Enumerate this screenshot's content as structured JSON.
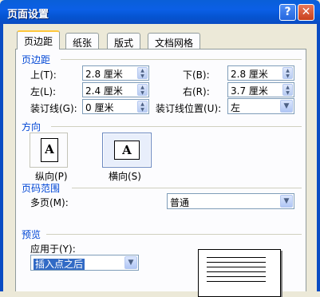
{
  "window": {
    "title": "页面设置",
    "help_button": "?",
    "close_button": "✕"
  },
  "tabs": [
    {
      "label": "页边距",
      "active": true
    },
    {
      "label": "纸张",
      "active": false
    },
    {
      "label": "版式",
      "active": false
    },
    {
      "label": "文档网格",
      "active": false
    }
  ],
  "margins": {
    "group_title": "页边距",
    "top": {
      "label": "上(T):",
      "value": "2.8 厘米"
    },
    "bottom": {
      "label": "下(B):",
      "value": "2.8 厘米"
    },
    "left": {
      "label": "左(L):",
      "value": "2.4 厘米"
    },
    "right": {
      "label": "右(R):",
      "value": "3.7 厘米"
    },
    "gutter": {
      "label": "装订线(G):",
      "value": "0 厘米"
    },
    "gutter_position": {
      "label": "装订线位置(U):",
      "value": "左"
    }
  },
  "orientation": {
    "group_title": "方向",
    "portrait": {
      "label": "纵向(P)",
      "glyph": "A",
      "selected": false
    },
    "landscape": {
      "label": "横向(S)",
      "glyph": "A",
      "selected": true
    }
  },
  "pages": {
    "group_title": "页码范围",
    "multiple_label": "多页(M):",
    "multiple_value": "普通"
  },
  "preview": {
    "group_title": "预览",
    "apply_to_label": "应用于(Y):",
    "apply_to_value": "插入点之后"
  },
  "colors": {
    "title_bar": "#0a5fd8",
    "group_title": "#0046d5",
    "selection": "#316ac5"
  }
}
